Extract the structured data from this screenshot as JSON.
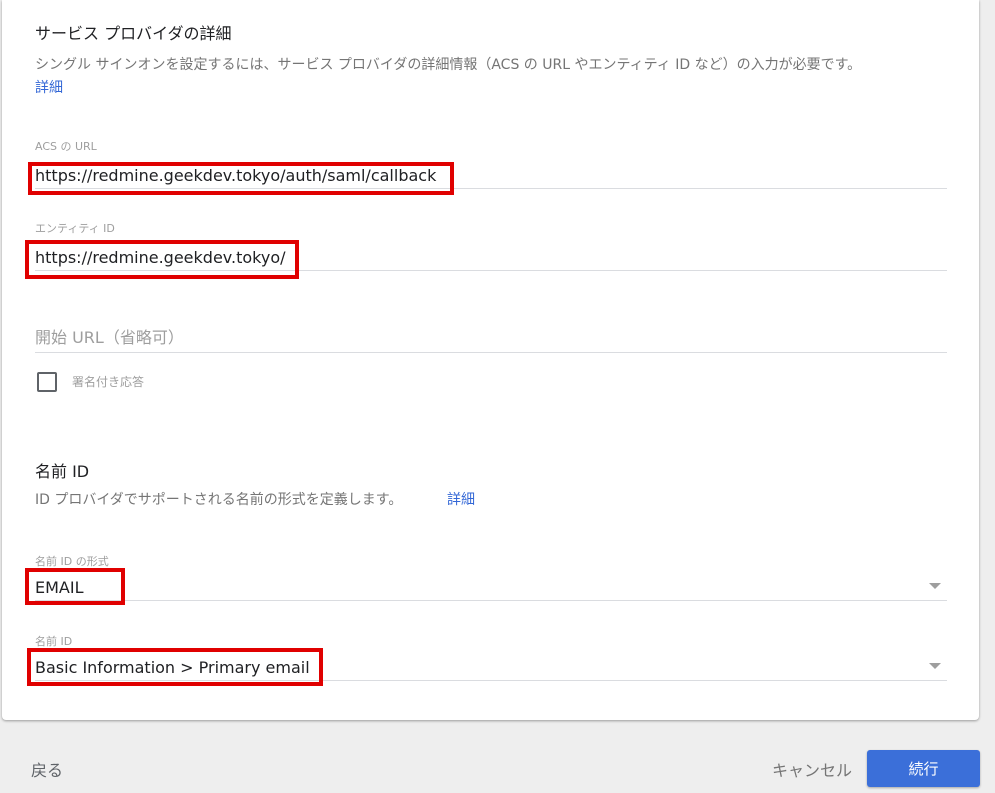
{
  "service_provider": {
    "title": "サービス プロバイダの詳細",
    "description": "シングル サインオンを設定するには、サービス プロバイダの詳細情報（ACS の URL やエンティティ ID など）の入力が必要です。",
    "details_link": "詳細",
    "acs_url": {
      "label": "ACS の URL",
      "value": "https://redmine.geekdev.tokyo/auth/saml/callback"
    },
    "entity_id": {
      "label": "エンティティ ID",
      "value": "https://redmine.geekdev.tokyo/"
    },
    "start_url": {
      "placeholder": "開始 URL（省略可）"
    },
    "signed_response": {
      "label": "署名付き応答",
      "checked": false
    }
  },
  "name_id": {
    "title": "名前 ID",
    "description": "ID プロバイダでサポートされる名前の形式を定義します。",
    "details_link": "詳細",
    "format": {
      "label": "名前 ID の形式",
      "value": "EMAIL"
    },
    "name_id_field": {
      "label": "名前 ID",
      "value": "Basic Information > Primary email"
    }
  },
  "footer": {
    "back_label": "戻る",
    "cancel_label": "キャンセル",
    "continue_label": "続行"
  },
  "colors": {
    "highlight": "#e00000",
    "primary_button": "#3b6fd9",
    "link": "#3367d6"
  }
}
